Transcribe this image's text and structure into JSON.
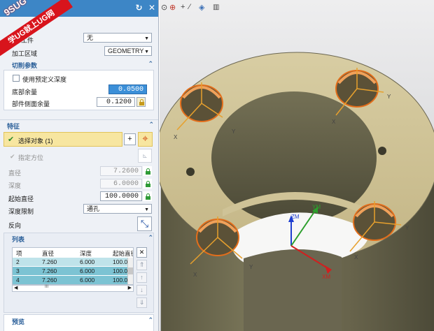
{
  "watermark": {
    "top": "9SUG",
    "band": "学UG就上UG网"
  },
  "title_controls": {
    "reset": "↻",
    "close": "✕"
  },
  "header": {
    "part_label": "工件",
    "part_value": "无",
    "region_label": "加工区域",
    "region_value": "GEOMETRY"
  },
  "cut_params": {
    "title": "切削参数",
    "use_predefined_depth": "使用预定义深度",
    "floor_stock_label": "底部余量",
    "floor_stock_value": "0.0500",
    "wall_stock_label": "部件侧面余量",
    "wall_stock_value": "0.1200"
  },
  "feature": {
    "title": "特征",
    "select_object": "选择对象 (1)",
    "specify_orientation": "指定方位",
    "diameter_label": "直径",
    "diameter_value": "7.2600",
    "depth_label": "深度",
    "depth_value": "6.0000",
    "start_diameter_label": "起始直径",
    "start_diameter_value": "100.0000",
    "depth_limit_label": "深度限制",
    "depth_limit_value": "通孔",
    "reverse_label": "反向"
  },
  "list": {
    "title": "列表",
    "columns": [
      "项",
      "直径",
      "深度",
      "起始直径"
    ],
    "rows": [
      [
        "2",
        "7.260",
        "6.000",
        "100.0"
      ],
      [
        "3",
        "7.260",
        "6.000",
        "100.0"
      ],
      [
        "4",
        "7.260",
        "6.000",
        "100.0"
      ]
    ],
    "hscroll_mark": "III"
  },
  "preview": {
    "title": "预览"
  },
  "axes": {
    "x": "X",
    "y": "Y",
    "zm": "ZM",
    "ym": "YM",
    "xm": "XM"
  },
  "colors": {
    "titlebar": "#3d86c6",
    "part": "#c8b98a",
    "hole": "#d66a1c",
    "accent_bar": "#3b8fd8"
  }
}
